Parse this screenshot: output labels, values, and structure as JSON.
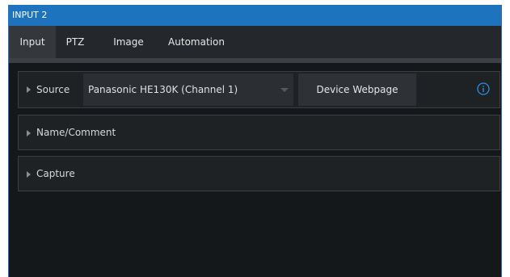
{
  "window": {
    "title": "INPUT 2"
  },
  "tabs": [
    {
      "label": "Input",
      "active": true
    },
    {
      "label": "PTZ",
      "active": false
    },
    {
      "label": "Image",
      "active": false
    },
    {
      "label": "Automation",
      "active": false
    }
  ],
  "sections": {
    "source": {
      "label": "Source",
      "selected_device": "Panasonic HE130K (Channel 1)",
      "device_webpage_label": "Device Webpage"
    },
    "name_comment": {
      "label": "Name/Comment"
    },
    "capture": {
      "label": "Capture"
    }
  },
  "colors": {
    "titlebar": "#1e73be",
    "accent_info": "#2a8ee6",
    "background": "#16191c"
  },
  "icons": {
    "info": "info-circle-icon",
    "expand": "triangle-right-icon",
    "dropdown": "chevron-down-icon"
  }
}
